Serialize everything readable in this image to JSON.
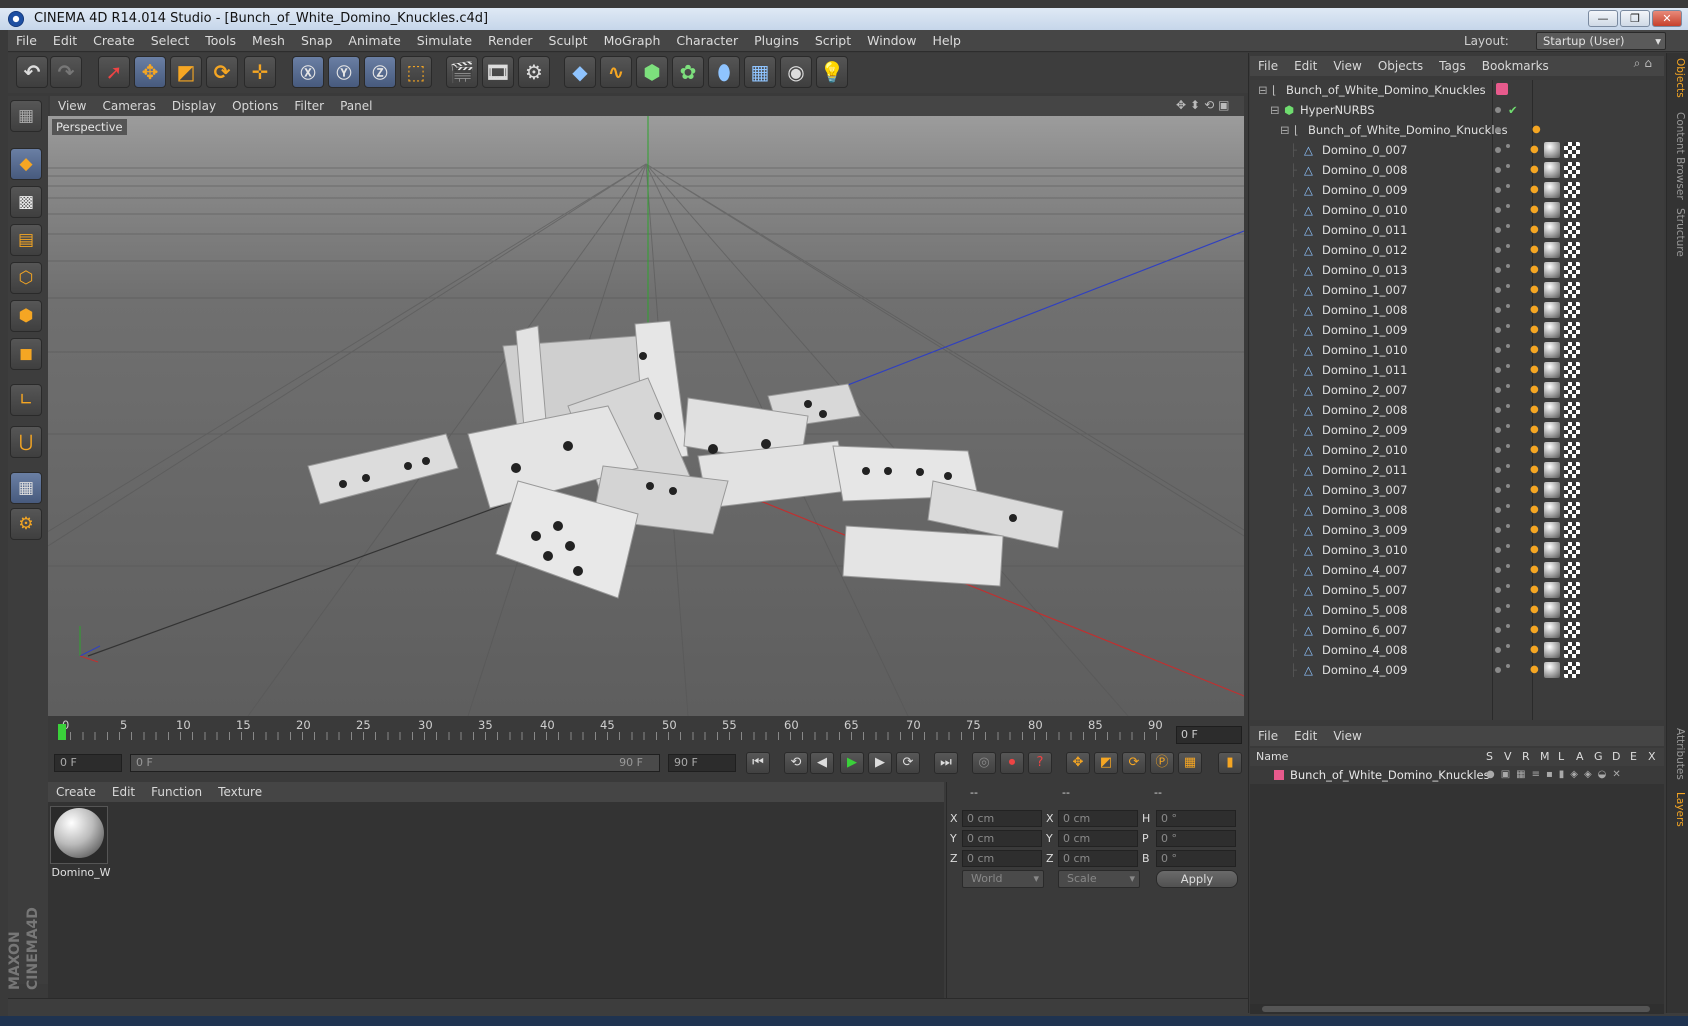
{
  "window": {
    "title": "CINEMA 4D R14.014 Studio - [Bunch_of_White_Domino_Knuckles.c4d]",
    "minimize": "—",
    "maximize": "❐",
    "close": "✕"
  },
  "menubar": [
    "File",
    "Edit",
    "Create",
    "Select",
    "Tools",
    "Mesh",
    "Snap",
    "Animate",
    "Simulate",
    "Render",
    "Sculpt",
    "MoGraph",
    "Character",
    "Plugins",
    "Script",
    "Window",
    "Help"
  ],
  "layout": {
    "label": "Layout:",
    "value": "Startup (User)"
  },
  "viewport": {
    "menu": [
      "View",
      "Cameras",
      "Display",
      "Options",
      "Filter",
      "Panel"
    ],
    "label": "Perspective",
    "nav_icons": "✥⬍⟲▣"
  },
  "timeline": {
    "ticks": [
      "0",
      "5",
      "10",
      "15",
      "20",
      "25",
      "30",
      "35",
      "40",
      "45",
      "50",
      "55",
      "60",
      "65",
      "70",
      "75",
      "80",
      "85",
      "90"
    ],
    "current_frame": "0 F",
    "start_field": "0 F",
    "range_start": "0 F",
    "range_end": "90 F",
    "end_field": "90 F"
  },
  "material_manager": {
    "menu": [
      "Create",
      "Edit",
      "Function",
      "Texture"
    ],
    "material_name": "Domino_W"
  },
  "coordinates": {
    "headers": [
      "--",
      "--",
      "--"
    ],
    "rows": [
      {
        "a": "X",
        "av": "0 cm",
        "b": "X",
        "bv": "0 cm",
        "c": "H",
        "cv": "0 °"
      },
      {
        "a": "Y",
        "av": "0 cm",
        "b": "Y",
        "bv": "0 cm",
        "c": "P",
        "cv": "0 °"
      },
      {
        "a": "Z",
        "av": "0 cm",
        "b": "Z",
        "bv": "0 cm",
        "c": "B",
        "cv": "0 °"
      }
    ],
    "mode": "World",
    "transform": "Scale",
    "apply": "Apply"
  },
  "object_manager": {
    "menu": [
      "File",
      "Edit",
      "View",
      "Objects",
      "Tags",
      "Bookmarks"
    ],
    "root": "Bunch_of_White_Domino_Knuckles",
    "hypernurbs": "HyperNURBS",
    "group": "Bunch_of_White_Domino_Knuckles",
    "objects": [
      "Domino_0_007",
      "Domino_0_008",
      "Domino_0_009",
      "Domino_0_010",
      "Domino_0_011",
      "Domino_0_012",
      "Domino_0_013",
      "Domino_1_007",
      "Domino_1_008",
      "Domino_1_009",
      "Domino_1_010",
      "Domino_1_011",
      "Domino_2_007",
      "Domino_2_008",
      "Domino_2_009",
      "Domino_2_010",
      "Domino_2_011",
      "Domino_3_007",
      "Domino_3_008",
      "Domino_3_009",
      "Domino_3_010",
      "Domino_4_007",
      "Domino_5_007",
      "Domino_5_008",
      "Domino_6_007",
      "Domino_4_008",
      "Domino_4_009"
    ],
    "checkmark": "✔"
  },
  "layer_manager": {
    "menu": [
      "File",
      "Edit",
      "View"
    ],
    "name_header": "Name",
    "columns": [
      "S",
      "V",
      "R",
      "M",
      "L",
      "A",
      "G",
      "D",
      "E",
      "X"
    ],
    "layer_name": "Bunch_of_White_Domino_Knuckles"
  },
  "right_tabs": [
    "Objects",
    "Content Browser",
    "Structure",
    "Attributes",
    "Layers"
  ],
  "branding": "MAXON CINEMA4D",
  "colors": {
    "accent": "#f5a623",
    "selection": "#5a6f94",
    "layer_color": "#e75a8c",
    "axis_x": "#c03030",
    "axis_y": "#2fa32f",
    "axis_z": "#3040c0"
  }
}
